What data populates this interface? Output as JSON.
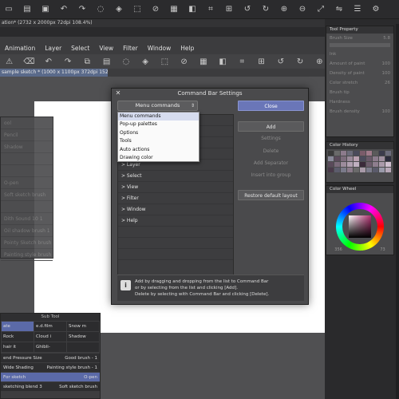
{
  "title_strip": "ation* (2732 x 2000px 72dpi 108.4%)",
  "menubar": [
    "Animation",
    "Layer",
    "Select",
    "View",
    "Filter",
    "Window",
    "Help"
  ],
  "canvas_tab": "sample sketch * (1000 x 1100px 372dpi 152.9%)",
  "brush_panel": {
    "rows": [
      "ool",
      "Pencil",
      "Shadow",
      "",
      "",
      "O-pen",
      "Soft sketch brush",
      "",
      "Dith Sound 10 1",
      "Oil shadow brush 1",
      "Pointy Sketch brush",
      "Painting style brush"
    ]
  },
  "subtool": {
    "title": "Sub Tool",
    "grid": [
      {
        "label": "ate",
        "selected": true
      },
      {
        "label": "e.d.film",
        "selected": false
      },
      {
        "label": "Snow m",
        "selected": false
      },
      {
        "label": "Rock",
        "selected": false
      },
      {
        "label": "Cloud i",
        "selected": false
      },
      {
        "label": "Shadow",
        "selected": false
      },
      {
        "label": "hair it",
        "selected": false
      },
      {
        "label": "Ghibli-",
        "selected": false
      },
      {
        "label": "",
        "selected": false
      }
    ],
    "list": [
      {
        "left": "end Pressure Size",
        "right": "Good brush - 1",
        "selected": false
      },
      {
        "left": "Wide Shading",
        "right": "Painting style brush - 1",
        "selected": false
      },
      {
        "left": "For sketch",
        "right": "O-pen",
        "selected": true
      },
      {
        "left": "sketching blend 3",
        "right": "Soft sketch brush",
        "selected": false
      }
    ]
  },
  "tool_property": {
    "title": "Tool Property",
    "rows": [
      {
        "label": "Brush Size",
        "value": "5.8"
      },
      {
        "label": "Ink",
        "value": ""
      },
      {
        "label": "Amount of paint",
        "value": "100"
      },
      {
        "label": "Density of paint",
        "value": "100"
      },
      {
        "label": "Color stretch",
        "value": "26"
      },
      {
        "label": "Brush tip",
        "value": ""
      },
      {
        "label": "Hardness",
        "value": ""
      },
      {
        "label": "Brush density",
        "value": "100"
      }
    ]
  },
  "color_history": {
    "title": "Color History",
    "colors": [
      "#3a3a3a",
      "#6a6a6a",
      "#8c7b8c",
      "#6b6b7a",
      "#4a4a5a",
      "#7a5c6a",
      "#a07a8a",
      "#5a5a5a",
      "#3c3c4c",
      "#6c6c7c",
      "#8a8a9a",
      "#5c4c5c",
      "#7c6c7c",
      "#9a8a9a",
      "#b9a0b0",
      "#4c4c5c",
      "#6a5a6a",
      "#8c7c8c",
      "#a090a0",
      "#2c2c3c",
      "#5a4a5a",
      "#7a6a7a",
      "#9c8c9c",
      "#b0a0b0",
      "#c0b0c0",
      "#3a2a3a",
      "#6c5c6c",
      "#8e7e8e",
      "#aa9aaa",
      "#d0c0d0",
      "#4a3a4a",
      "#5c5c6c",
      "#7a7a8a",
      "#8a7a8a",
      "#6a6a6a",
      "#a89aa8",
      "#7c7c8c",
      "#5a5a6a",
      "#9a9aaa",
      "#b8a8b8"
    ]
  },
  "color_wheel": {
    "title": "Color Wheel",
    "values": [
      "356",
      "44",
      "73"
    ]
  },
  "dialog": {
    "title": "Command Bar Settings",
    "select_value": "Menu commands",
    "dropdown_options": [
      "Menu commands",
      "Pop-up palettes",
      "Options",
      "Tools",
      "Auto actions",
      "Drawing color"
    ],
    "list_items": [
      "",
      "",
      "",
      "",
      "> Layer",
      "> Select",
      "> View",
      "> Filter",
      "> Window",
      "> Help",
      "",
      "",
      "",
      ""
    ],
    "buttons": {
      "close": "Close",
      "add": "Add",
      "settings": "Settings",
      "delete": "Delete",
      "add_separator": "Add Separator",
      "insert_into_group": "Insert into group",
      "restore": "Restore default layout"
    },
    "info_icon": "i",
    "info_lines": [
      "Add by dragging and dropping from the list to Command Bar",
      "or by selecting from the list and clicking [Add].",
      "Delete by selecting with Command Bar and clicking [Delete]."
    ]
  }
}
